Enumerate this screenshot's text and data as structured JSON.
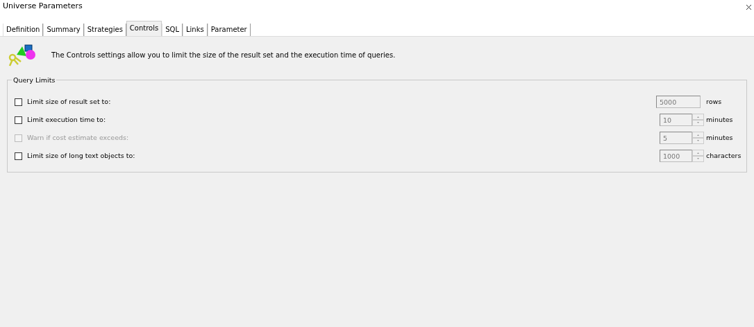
{
  "window": {
    "title": "Universe Parameters"
  },
  "tabs": [
    {
      "label": "Definition",
      "selected": false
    },
    {
      "label": "Summary",
      "selected": false
    },
    {
      "label": "Strategies",
      "selected": false
    },
    {
      "label": "Controls",
      "selected": true
    },
    {
      "label": "SQL",
      "selected": false
    },
    {
      "label": "Links",
      "selected": false
    },
    {
      "label": "Parameter",
      "selected": false
    }
  ],
  "description": "The Controls settings allow you to limit the size of the result set and the execution time of queries.",
  "query_limits": {
    "title": "Query Limits",
    "rows": [
      {
        "kind": "plain",
        "label": "Limit size of result set to:",
        "checked": false,
        "disabled": false,
        "value": "5000",
        "unit": "rows"
      },
      {
        "kind": "spin",
        "label": "Limit execution time to:",
        "checked": false,
        "disabled": false,
        "value": "10",
        "unit": "minutes"
      },
      {
        "kind": "spin",
        "label": "Warn if cost estimate exceeds:",
        "checked": false,
        "disabled": true,
        "value": "5",
        "unit": "minutes"
      },
      {
        "kind": "spin",
        "label": "Limit size of long text objects to:",
        "checked": false,
        "disabled": false,
        "value": "1000",
        "unit": "characters"
      }
    ]
  }
}
